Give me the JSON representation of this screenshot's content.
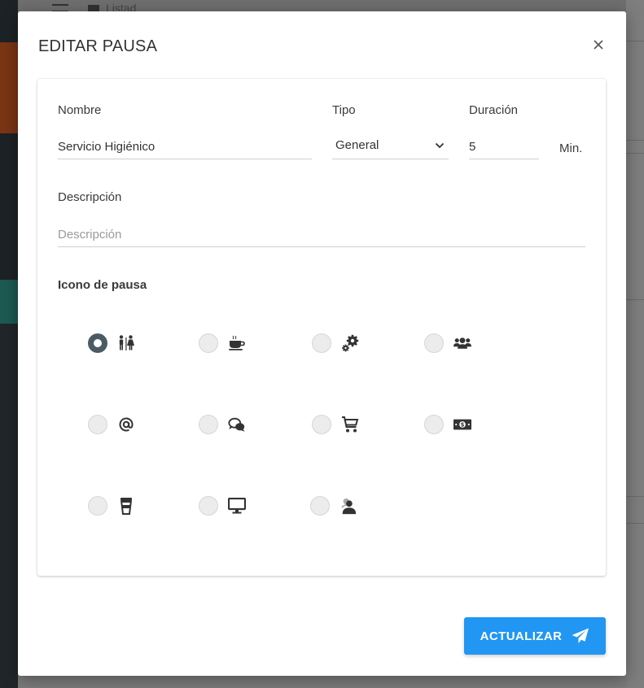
{
  "background": {
    "title_fragment": "Listad"
  },
  "modal": {
    "title": "EDITAR PAUSA",
    "close_icon": "close-icon"
  },
  "form": {
    "nombre": {
      "label": "Nombre",
      "value": "Servicio Higiénico"
    },
    "tipo": {
      "label": "Tipo",
      "selected": "General"
    },
    "duracion": {
      "label": "Duración",
      "value": "5",
      "unit": "Min."
    },
    "descripcion": {
      "label": "Descripción",
      "value": "",
      "placeholder": "Descripción"
    },
    "icono": {
      "label": "Icono de pausa",
      "selected_index": 0,
      "options": [
        {
          "icon": "restroom-icon"
        },
        {
          "icon": "coffee-icon"
        },
        {
          "icon": "cogs-icon"
        },
        {
          "icon": "users-icon"
        },
        {
          "icon": "at-icon"
        },
        {
          "icon": "comments-icon"
        },
        {
          "icon": "cart-icon"
        },
        {
          "icon": "money-icon"
        },
        {
          "icon": "cup-icon"
        },
        {
          "icon": "desktop-icon"
        },
        {
          "icon": "user-secret-icon"
        }
      ]
    }
  },
  "actions": {
    "submit_label": "ACTUALIZAR",
    "submit_icon": "paper-plane-icon",
    "submit_color": "#2196f3"
  }
}
